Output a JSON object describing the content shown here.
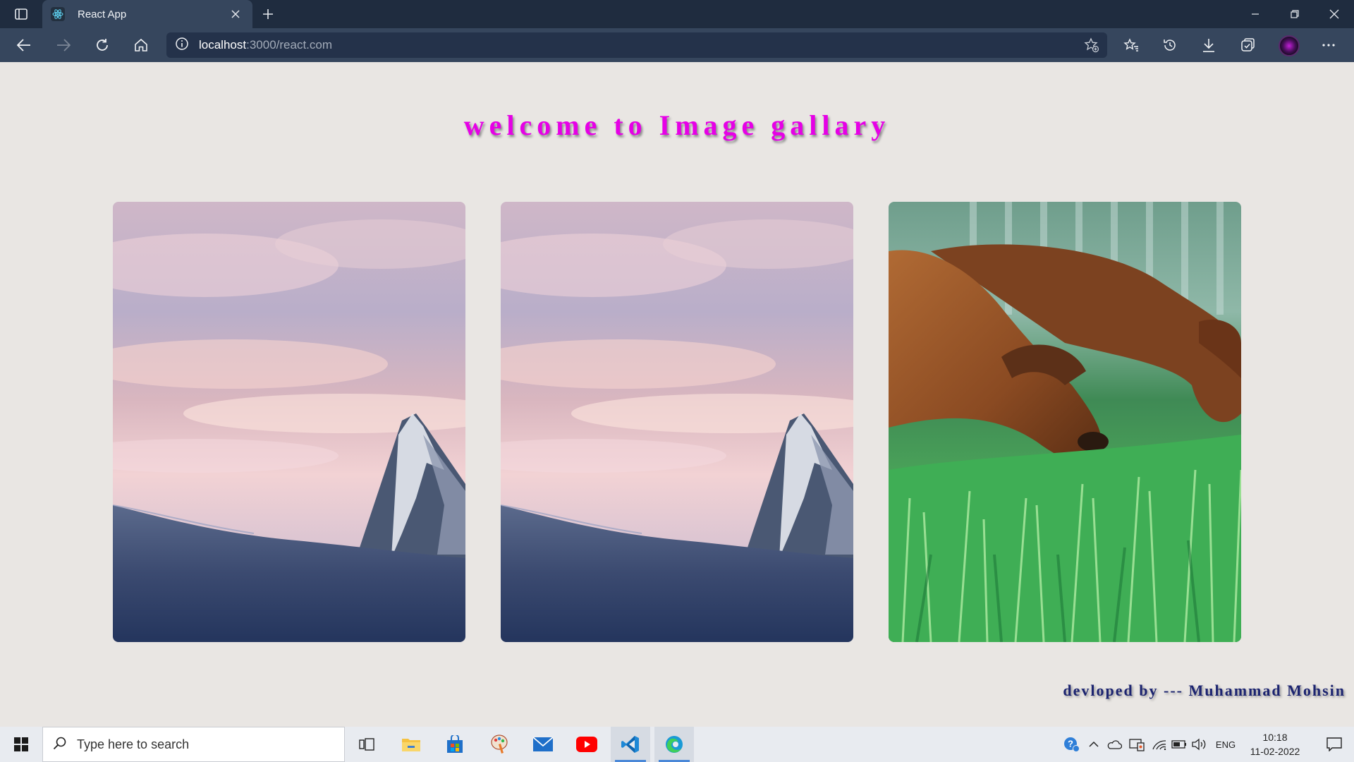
{
  "browser": {
    "tab_title": "React App",
    "url_host": "localhost",
    "url_path": ":3000/react.com"
  },
  "page": {
    "heading": "welcome to Image gallary",
    "footer_credit": "devloped by --- Muhammad Mohsin",
    "gallery": [
      {
        "subject": "mountain-sunset"
      },
      {
        "subject": "mountain-sunset"
      },
      {
        "subject": "dogs-in-grass"
      }
    ]
  },
  "taskbar": {
    "search_placeholder": "Type here to search",
    "language": "ENG",
    "time": "10:18",
    "date": "11-02-2022",
    "apps": [
      "task-view",
      "file-explorer",
      "store",
      "paint",
      "mail",
      "youtube",
      "vscode",
      "edge"
    ]
  },
  "colors": {
    "heading": "#e600e6",
    "credit": "#1c2470",
    "titlebar": "#1f2c3f",
    "toolbar": "#36465d",
    "page_bg": "#e9e6e3"
  }
}
